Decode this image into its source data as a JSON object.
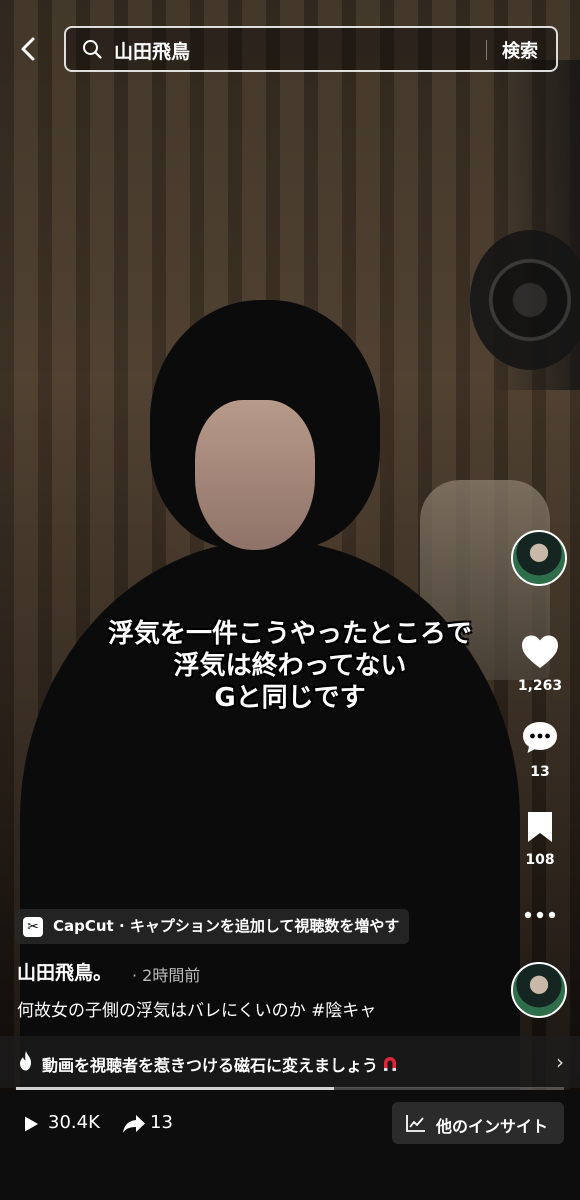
{
  "search": {
    "query": "山田飛鳥",
    "button_label": "検索"
  },
  "video": {
    "caption_lines": [
      "浮気を一件こうやったところで",
      "浮気は終わってない",
      "Gと同じです"
    ]
  },
  "rail": {
    "likes": "1,263",
    "comments": "13",
    "bookmarks": "108"
  },
  "capcut": {
    "label": "CapCut · キャプションを追加して視聴数を増やす"
  },
  "post": {
    "author": "山田飛鳥。",
    "time": "· 2時間前",
    "description": "何故女の子側の浮気はバレにくいのか #陰キャ"
  },
  "promo": {
    "text": "動画を視聴者を惹きつける磁石に変えましょう"
  },
  "playback": {
    "progress": 0.58
  },
  "footer": {
    "views": "30.4K",
    "shares": "13",
    "insight_label": "他のインサイト"
  }
}
